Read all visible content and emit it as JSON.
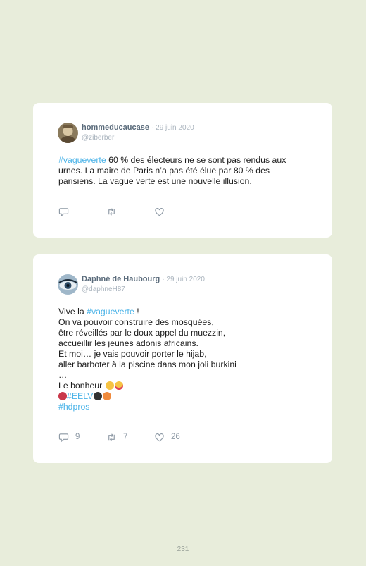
{
  "tweets": [
    {
      "name": "hommeducaucase",
      "date": "· 29 juin 2020",
      "handle": "@ziberber",
      "lines": [
        {
          "tag": "#vagueverte",
          "text": " 60 % des électeurs ne se sont pas rendus aux"
        },
        {
          "tag": "",
          "text": "urnes. La maire de Paris n’a pas été élue par 80 % des"
        },
        {
          "tag": "",
          "text": "parisiens. La vague verte est une nouvelle illusion."
        }
      ],
      "actions": {
        "reply": "",
        "retweet": "",
        "like": ""
      }
    },
    {
      "name": "Daphné de Haubourg",
      "date": "· 29 juin 2020",
      "handle": "@daphneH87",
      "intro_text": "Vive la ",
      "intro_tag": "#vagueverte",
      "intro_end": " !",
      "lines": [
        "On va pouvoir construire des mosquées,",
        "être réveillés par le doux appel du muezzin,",
        "accueillir les jeunes adonis africains.",
        "Et moi… je vais pouvoir porter le hijab,",
        "aller barboter à la piscine dans mon joli burkini",
        "…",
        "Le bonheur"
      ],
      "tag2": "#EELV",
      "tag3": "#hdpros",
      "actions": {
        "reply": "9",
        "retweet": "7",
        "like": "26"
      }
    }
  ],
  "page_number": "231",
  "colors": {
    "background": "#e8eddb",
    "hashtag": "#4ab3e8",
    "name": "#5a6b7b"
  },
  "icons": [
    "reply-icon",
    "retweet-icon",
    "like-icon"
  ]
}
